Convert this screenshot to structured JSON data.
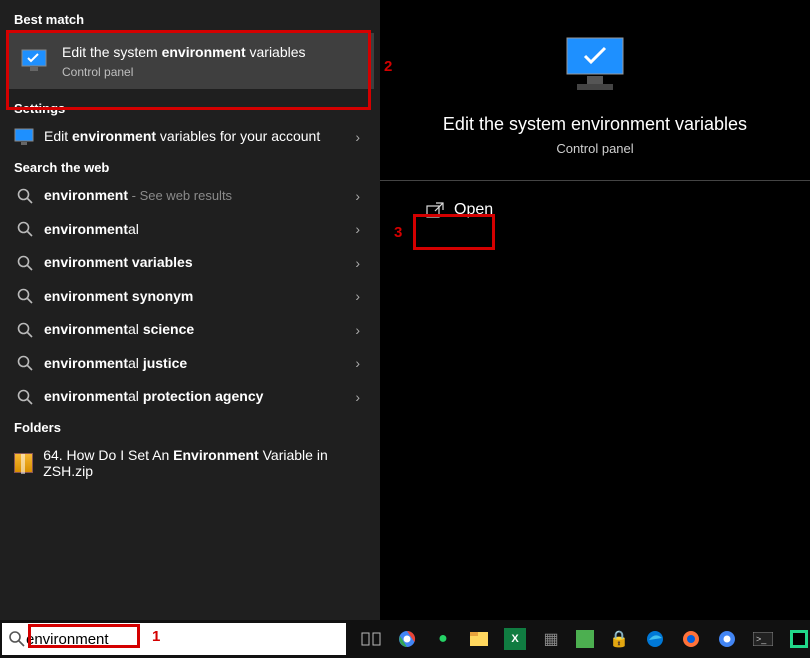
{
  "sections": {
    "best_match": "Best match",
    "settings": "Settings",
    "search_web": "Search the web",
    "folders": "Folders"
  },
  "best_match_item": {
    "title_prefix": "Edit the system ",
    "title_bold": "environment",
    "title_suffix": " variables",
    "subtitle": "Control panel"
  },
  "settings_item": {
    "prefix": "Edit ",
    "bold": "environment",
    "suffix": " variables for your account"
  },
  "web_results": [
    {
      "bold": "environment",
      "suffix": "",
      "trail": " - See web results"
    },
    {
      "bold": "environment",
      "suffix": "al",
      "trail": ""
    },
    {
      "bold": "environment",
      "suffix": " ",
      "trail": "",
      "bold2": "variables"
    },
    {
      "bold": "environment",
      "suffix": " ",
      "trail": "",
      "bold2": "synonym"
    },
    {
      "bold": "environment",
      "suffix": "al ",
      "trail": "",
      "bold2": "science"
    },
    {
      "bold": "environment",
      "suffix": "al ",
      "trail": "",
      "bold2": "justice"
    },
    {
      "bold": "environment",
      "suffix": "al ",
      "trail": "",
      "bold2": "protection agency"
    }
  ],
  "folder_item": {
    "prefix": "64. How Do I Set An ",
    "bold": "Environment",
    "suffix": " Variable in ZSH.zip"
  },
  "right": {
    "title": "Edit the system environment variables",
    "subtitle": "Control panel",
    "open": "Open"
  },
  "search": {
    "value": "environment"
  },
  "annotations": {
    "a1": "1",
    "a2": "2",
    "a3": "3"
  }
}
